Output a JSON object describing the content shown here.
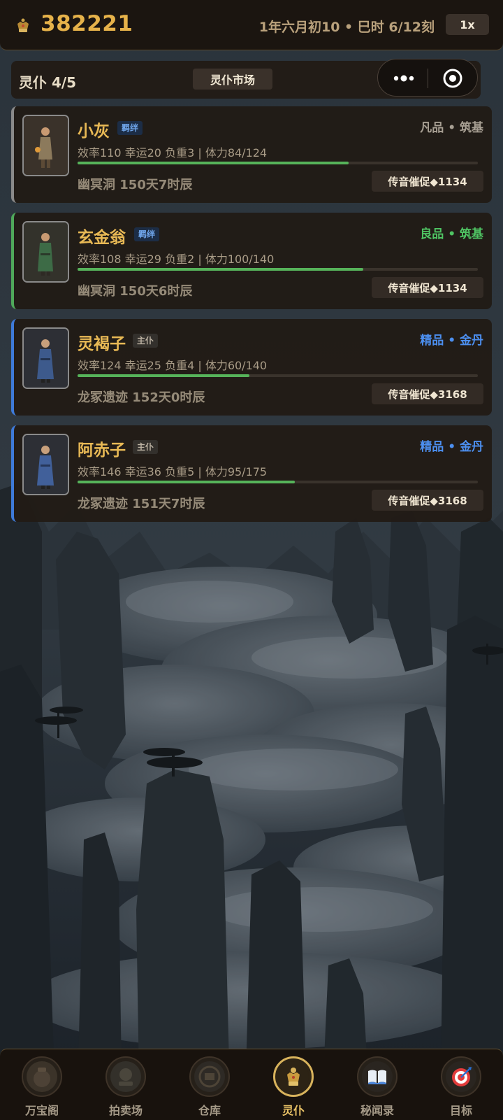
{
  "topbar": {
    "gold": "382221",
    "game_time": "1年六月初10 • 巳时 6/12刻",
    "speed_label": "1x"
  },
  "header": {
    "servant_count": "灵仆 4/5",
    "market_label": "灵仆市场"
  },
  "servants": [
    {
      "name": "小灰",
      "tag": "羁绊",
      "rank": "凡品 • 筑基",
      "rank_color": "#a79f93",
      "accent_color": "#8a8a8a",
      "stats": "效率110 幸运20 负重3 | 体力84/124",
      "stamina_ratio": 0.677,
      "location": "幽冥洞 150天7时辰",
      "urge_label": "传音催促◆1134"
    },
    {
      "name": "玄金翁",
      "tag": "羁绊",
      "rank": "良品 • 筑基",
      "rank_color": "#4fc463",
      "accent_color": "#4fa85a",
      "stats": "效率108 幸运29 负重2 | 体力100/140",
      "stamina_ratio": 0.714,
      "location": "幽冥洞 150天6时辰",
      "urge_label": "传音催促◆1134"
    },
    {
      "name": "灵褐子",
      "tag": "主仆",
      "rank": "精品 • 金丹",
      "rank_color": "#4c8ff0",
      "accent_color": "#3e7ad8",
      "stats": "效率124 幸运25 负重4 | 体力60/140",
      "stamina_ratio": 0.429,
      "location": "龙冢遗迹 152天0时辰",
      "urge_label": "传音催促◆3168"
    },
    {
      "name": "阿赤子",
      "tag": "主仆",
      "rank": "精品 • 金丹",
      "rank_color": "#4c8ff0",
      "accent_color": "#3e7ad8",
      "stats": "效率146 幸运36 负重5 | 体力95/175",
      "stamina_ratio": 0.543,
      "location": "龙冢遗迹 151天7时辰",
      "urge_label": "传音催促◆3168"
    }
  ],
  "nav": [
    {
      "label": "万宝阁",
      "icon": "treasure-pavilion-icon"
    },
    {
      "label": "拍卖场",
      "icon": "auction-icon"
    },
    {
      "label": "仓库",
      "icon": "warehouse-icon"
    },
    {
      "label": "灵仆",
      "icon": "servant-icon",
      "active": true
    },
    {
      "label": "秘闻录",
      "icon": "book-icon"
    },
    {
      "label": "目标",
      "icon": "target-icon"
    }
  ]
}
